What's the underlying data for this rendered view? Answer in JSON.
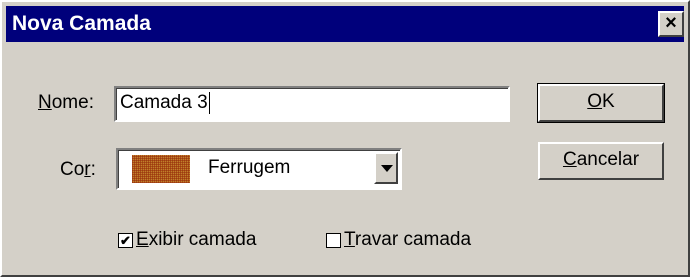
{
  "window": {
    "title": "Nova Camada",
    "close_label": "×"
  },
  "name_field": {
    "label_access_key": "N",
    "label_rest": "ome:",
    "value": "Camada 3"
  },
  "color_field": {
    "label_start": "Co",
    "label_access_key": "r",
    "label_end": ":",
    "selected_value": "Ferrugem",
    "swatch_color": "#b8722c"
  },
  "buttons": {
    "ok_access_key": "O",
    "ok_rest": "K",
    "cancel_access_key": "C",
    "cancel_rest": "ancelar"
  },
  "checkboxes": {
    "show_layer": {
      "checked": true,
      "mark": "✔",
      "access_key": "E",
      "rest": "xibir camada"
    },
    "lock_layer": {
      "checked": false,
      "mark": "",
      "access_key": "T",
      "rest": "ravar camada"
    }
  },
  "colors": {
    "titlebar": "#00007b",
    "dialog_face": "#d4d0c8"
  }
}
